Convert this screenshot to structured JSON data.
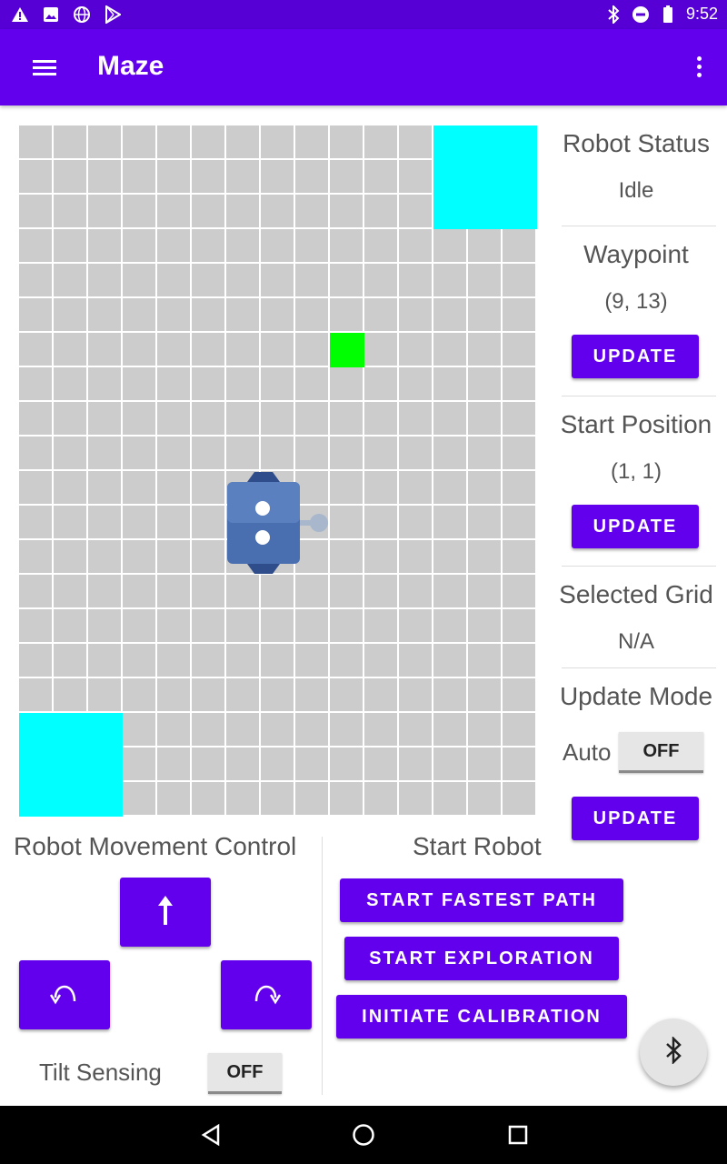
{
  "status_bar": {
    "time": "9:52"
  },
  "app_bar": {
    "title": "Maze"
  },
  "side_panel": {
    "robot_status_title": "Robot Status",
    "robot_status_value": "Idle",
    "waypoint_title": "Waypoint",
    "waypoint_value": "(9, 13)",
    "waypoint_update_label": "UPDATE",
    "start_position_title": "Start Position",
    "start_position_value": "(1, 1)",
    "start_position_update_label": "UPDATE",
    "selected_grid_title": "Selected Grid",
    "selected_grid_value": "N/A",
    "update_mode_title": "Update Mode",
    "auto_label": "Auto",
    "auto_toggle_label": "OFF",
    "update_mode_update_label": "UPDATE"
  },
  "movement": {
    "title": "Robot Movement Control",
    "tilt_label": "Tilt Sensing",
    "tilt_toggle_label": "OFF"
  },
  "start_robot": {
    "title": "Start Robot",
    "fastest_path_label": "START FASTEST PATH",
    "exploration_label": "START EXPLORATION",
    "calibration_label": "INITIATE CALIBRATION"
  },
  "maze": {
    "columns": 15,
    "rows": 20,
    "colors": {
      "cell": "#cccccc",
      "goal_zone": "#00ffff",
      "start_zone": "#00ffff",
      "waypoint": "#00ff00",
      "robot": "#4a6fb0"
    }
  },
  "colors": {
    "primary": "#6200ee",
    "status_bar": "#5600d6"
  },
  "icons": [
    "warning-icon",
    "image-icon",
    "globe-icon",
    "play-store-icon",
    "bluetooth-icon",
    "dnd-icon",
    "battery-icon",
    "menu-icon",
    "more-vert-icon",
    "arrow-up-icon",
    "rotate-left-icon",
    "rotate-right-icon",
    "back-icon",
    "home-icon",
    "recents-icon"
  ]
}
